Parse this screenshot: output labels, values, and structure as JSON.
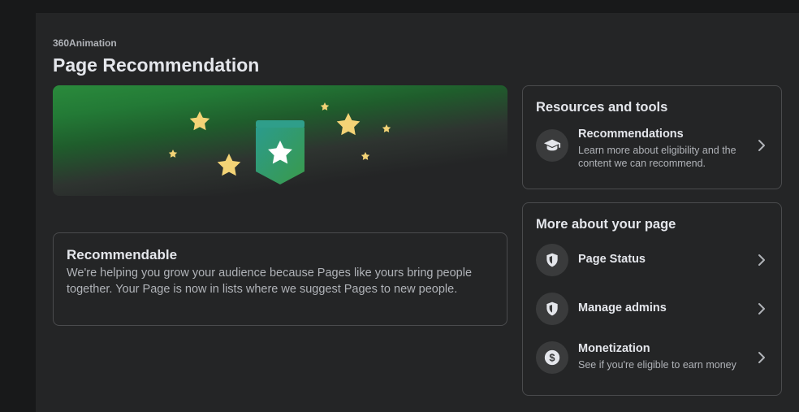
{
  "header": {
    "page_name": "360Animation",
    "title": "Page Recommendation"
  },
  "status_card": {
    "title": "Recommendable",
    "body": "We're helping you grow your audience because Pages like yours bring people together. Your Page is now in lists where we suggest Pages to new people."
  },
  "resources": {
    "heading": "Resources and tools",
    "items": [
      {
        "title": "Recommendations",
        "description": "Learn more about eligibility and the content we can recommend.",
        "icon": "graduation-cap-icon"
      }
    ]
  },
  "more": {
    "heading": "More about your page",
    "items": [
      {
        "title": "Page Status",
        "description": "",
        "icon": "shield-icon"
      },
      {
        "title": "Manage admins",
        "description": "",
        "icon": "shield-icon"
      },
      {
        "title": "Monetization",
        "description": "See if you're eligible to earn money",
        "icon": "dollar-icon"
      }
    ]
  },
  "colors": {
    "background": "#18191a",
    "surface": "#242526",
    "border": "#4a4b4d",
    "text_primary": "#e4e6eb",
    "text_secondary": "#b0b3b8",
    "banner_green": "#2a8a3c",
    "star": "#f3d376",
    "badge_teal": "#2b9b8c"
  }
}
